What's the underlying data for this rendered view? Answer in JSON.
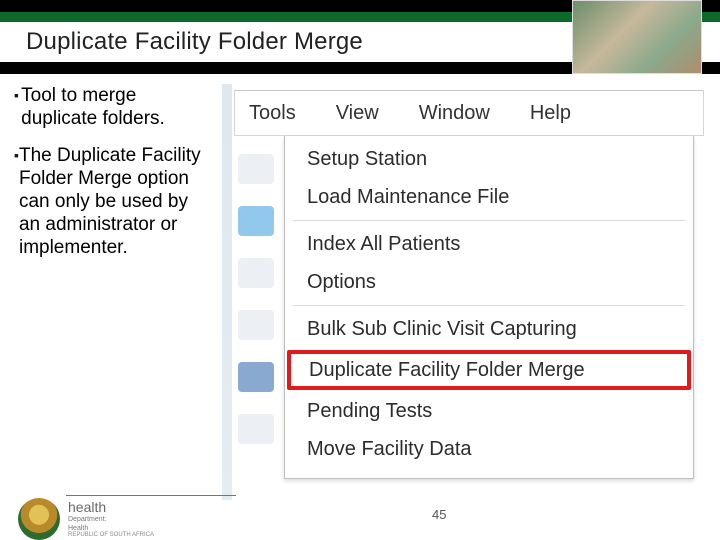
{
  "header": {
    "title": "Duplicate Facility Folder Merge"
  },
  "bullets": [
    "Tool to merge duplicate folders.",
    "The Duplicate Facility Folder Merge option can only be used by an administrator or implementer."
  ],
  "menubar": {
    "items": [
      "Tools",
      "View",
      "Window",
      "Help"
    ]
  },
  "tools_menu": {
    "items": [
      {
        "label": "Setup Station"
      },
      {
        "label": "Load Maintenance File"
      },
      {
        "sep": true
      },
      {
        "label": "Index All Patients"
      },
      {
        "label": "Options"
      },
      {
        "sep": true
      },
      {
        "label": "Bulk Sub Clinic Visit Capturing"
      },
      {
        "label": "Duplicate Facility Folder Merge",
        "highlight": true
      },
      {
        "label": "Pending Tests"
      },
      {
        "label": "Move Facility Data"
      }
    ]
  },
  "footer": {
    "dept": "health",
    "line2": "Department:",
    "line3": "Health",
    "line4": "REPUBLIC OF SOUTH AFRICA",
    "page": "45"
  }
}
